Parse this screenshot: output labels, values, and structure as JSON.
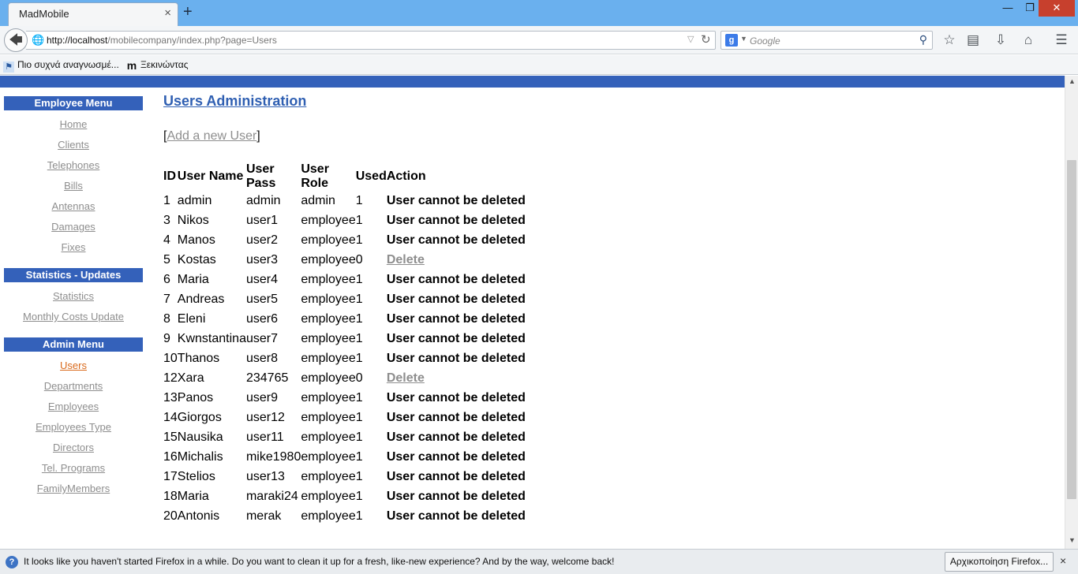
{
  "browser": {
    "tab_title": "MadMobile",
    "tab_close": "×",
    "new_tab": "+",
    "window_min": "—",
    "window_max": "❐",
    "window_close": "✕",
    "url_host": "http://localhost",
    "url_path": "/mobilecompany/index.php?page=Users",
    "search_placeholder": "Google",
    "search_engine_icon": "g-icon",
    "bookmarks": [
      "Πιο συχνά αναγνωσμέ...",
      "Ξεκινώντας"
    ]
  },
  "sidebar": {
    "employee_menu": {
      "title": "Employee Menu",
      "items": [
        "Home",
        "Clients",
        "Telephones",
        "Bills",
        "Antennas",
        "Damages",
        "Fixes"
      ]
    },
    "stats_menu": {
      "title": "Statistics - Updates",
      "items": [
        "Statistics",
        "Monthly Costs Update"
      ]
    },
    "admin_menu": {
      "title": "Admin Menu",
      "items": [
        "Users",
        "Departments",
        "Employees",
        "Employees Type",
        "Directors",
        "Tel. Programs",
        "FamilyMembers"
      ],
      "active": "Users"
    }
  },
  "main": {
    "title": "Users Administration",
    "add_user_label": "Add a new User",
    "columns": [
      "ID",
      "User Name",
      "User Pass",
      "User Role",
      "Used",
      "Action"
    ],
    "rows": [
      {
        "id": "1",
        "name": "admin",
        "pass": "admin",
        "role": "admin",
        "used": "1",
        "action": "User cannot be deleted"
      },
      {
        "id": "3",
        "name": "Nikos",
        "pass": "user1",
        "role": "employee",
        "used": "1",
        "action": "User cannot be deleted"
      },
      {
        "id": "4",
        "name": "Manos",
        "pass": "user2",
        "role": "employee",
        "used": "1",
        "action": "User cannot be deleted"
      },
      {
        "id": "5",
        "name": "Kostas",
        "pass": "user3",
        "role": "employee",
        "used": "0",
        "action": "Delete"
      },
      {
        "id": "6",
        "name": "Maria",
        "pass": "user4",
        "role": "employee",
        "used": "1",
        "action": "User cannot be deleted"
      },
      {
        "id": "7",
        "name": "Andreas",
        "pass": "user5",
        "role": "employee",
        "used": "1",
        "action": "User cannot be deleted"
      },
      {
        "id": "8",
        "name": "Eleni",
        "pass": "user6",
        "role": "employee",
        "used": "1",
        "action": "User cannot be deleted"
      },
      {
        "id": "9",
        "name": "Kwnstantina",
        "pass": "user7",
        "role": "employee",
        "used": "1",
        "action": "User cannot be deleted"
      },
      {
        "id": "10",
        "name": "Thanos",
        "pass": "user8",
        "role": "employee",
        "used": "1",
        "action": "User cannot be deleted"
      },
      {
        "id": "12",
        "name": "Xara",
        "pass": "234765",
        "role": "employee",
        "used": "0",
        "action": "Delete"
      },
      {
        "id": "13",
        "name": "Panos",
        "pass": "user9",
        "role": "employee",
        "used": "1",
        "action": "User cannot be deleted"
      },
      {
        "id": "14",
        "name": "Giorgos",
        "pass": "user12",
        "role": "employee",
        "used": "1",
        "action": "User cannot be deleted"
      },
      {
        "id": "15",
        "name": "Nausika",
        "pass": "user11",
        "role": "employee",
        "used": "1",
        "action": "User cannot be deleted"
      },
      {
        "id": "16",
        "name": "Michalis",
        "pass": "mike1980",
        "role": "employee",
        "used": "1",
        "action": "User cannot be deleted"
      },
      {
        "id": "17",
        "name": "Stelios",
        "pass": "user13",
        "role": "employee",
        "used": "1",
        "action": "User cannot be deleted"
      },
      {
        "id": "18",
        "name": "Maria",
        "pass": "maraki24",
        "role": "employee",
        "used": "1",
        "action": "User cannot be deleted"
      },
      {
        "id": "20",
        "name": "Antonis",
        "pass": "merak",
        "role": "employee",
        "used": "1",
        "action": "User cannot be deleted"
      }
    ]
  },
  "notification": {
    "text": "It looks like you haven't started Firefox in a while. Do you want to clean it up for a fresh, like-new experience? And by the way, welcome back!",
    "button": "Αρχικοποίηση Firefox...",
    "close": "×"
  },
  "colors": {
    "header_blue": "#3461ba",
    "link_gray": "#8e8e8e",
    "active_orange": "#d96a1c",
    "title_blue": "#2f5fb2"
  }
}
